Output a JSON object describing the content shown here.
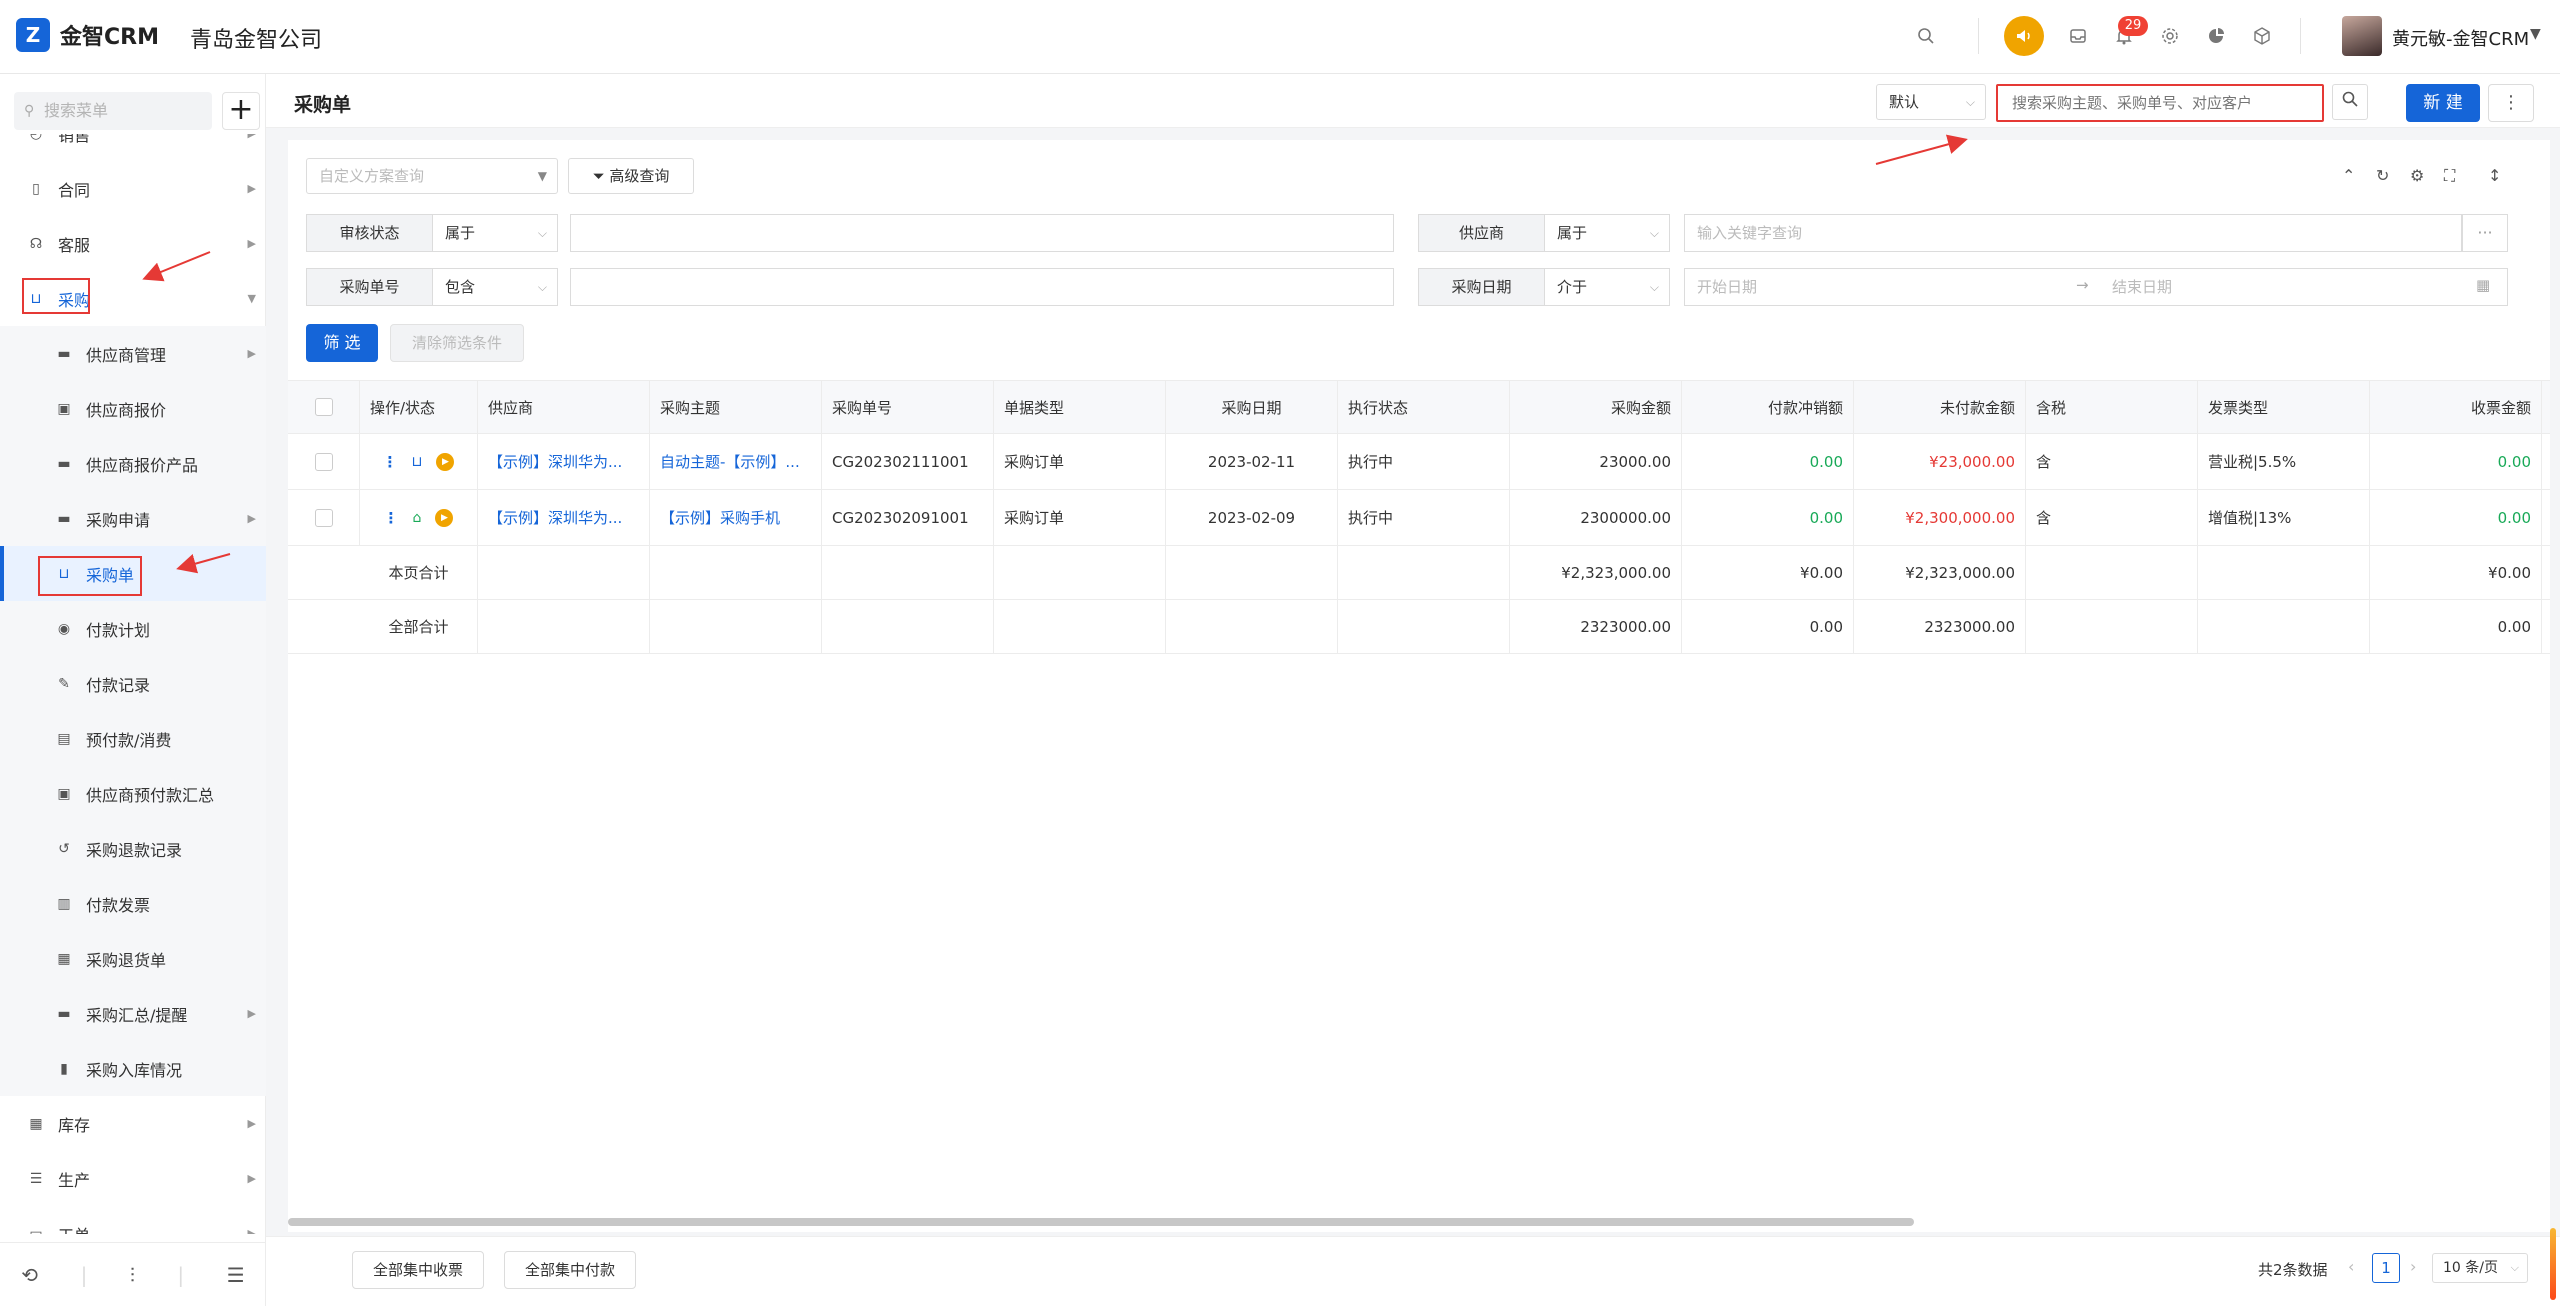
{
  "app": {
    "logo_text": "金智CRM",
    "company": "青岛金智公司"
  },
  "topbar": {
    "notification_count": "29",
    "user_name": "黄元敏-金智CRM"
  },
  "sidebar": {
    "search_placeholder": "搜索菜单",
    "items": [
      {
        "label": "销售",
        "icon": "sales-icon"
      },
      {
        "label": "合同",
        "icon": "contract-icon"
      },
      {
        "label": "客服",
        "icon": "headset-icon"
      },
      {
        "label": "采购",
        "icon": "basket-icon"
      },
      {
        "label": "供应商管理",
        "icon": "folder-icon"
      },
      {
        "label": "供应商报价",
        "icon": "doc-icon"
      },
      {
        "label": "供应商报价产品",
        "icon": "folder-icon"
      },
      {
        "label": "采购申请",
        "icon": "folder-icon"
      },
      {
        "label": "采购单",
        "icon": "basket-icon"
      },
      {
        "label": "付款计划",
        "icon": "clock-icon"
      },
      {
        "label": "付款记录",
        "icon": "pen-icon"
      },
      {
        "label": "预付款/消费",
        "icon": "card-icon"
      },
      {
        "label": "供应商预付款汇总",
        "icon": "doc-icon"
      },
      {
        "label": "采购退款记录",
        "icon": "refund-icon"
      },
      {
        "label": "付款发票",
        "icon": "invoice-icon"
      },
      {
        "label": "采购退货单",
        "icon": "return-icon"
      },
      {
        "label": "采购汇总/提醒",
        "icon": "folder-icon"
      },
      {
        "label": "采购入库情况",
        "icon": "stock-icon"
      },
      {
        "label": "库存",
        "icon": "warehouse-icon"
      },
      {
        "label": "生产",
        "icon": "production-icon"
      },
      {
        "label": "工单",
        "icon": "ticket-icon"
      }
    ]
  },
  "header": {
    "title": "采购单",
    "view_select": "默认",
    "search_placeholder": "搜索采购主题、采购单号、对应客户",
    "new_label": "新 建"
  },
  "filters": {
    "custom_placeholder": "自定义方案查询",
    "advanced_label": "高级查询",
    "audit_label": "审核状态",
    "audit_op": "属于",
    "supplier_label": "供应商",
    "supplier_op": "属于",
    "supplier_placeholder": "输入关键字查询",
    "order_no_label": "采购单号",
    "order_no_op": "包含",
    "date_label": "采购日期",
    "date_op": "介于",
    "date_start": "开始日期",
    "date_end": "结束日期",
    "filter_btn": "筛 选",
    "clear_btn": "清除筛选条件"
  },
  "table": {
    "headers": [
      "操作/状态",
      "供应商",
      "采购主题",
      "采购单号",
      "单据类型",
      "采购日期",
      "执行状态",
      "采购金额",
      "付款冲销额",
      "未付款金额",
      "含税",
      "发票类型",
      "收票金额"
    ],
    "rows": [
      {
        "supplier": "【示例】深圳华为...",
        "subject": "自动主题-【示例】...",
        "order_no": "CG202302111001",
        "doc_type": "采购订单",
        "date": "2023-02-11",
        "exec_status": "执行中",
        "amount": "23000.00",
        "offset": "0.00",
        "unpaid": "¥23,000.00",
        "tax": "含",
        "invoice_type": "营业税|5.5%",
        "received": "0.00"
      },
      {
        "supplier": "【示例】深圳华为...",
        "subject": "【示例】采购手机",
        "order_no": "CG202302091001",
        "doc_type": "采购订单",
        "date": "2023-02-09",
        "exec_status": "执行中",
        "amount": "2300000.00",
        "offset": "0.00",
        "unpaid": "¥2,300,000.00",
        "tax": "含",
        "invoice_type": "增值税|13%",
        "received": "0.00"
      }
    ],
    "page_total": {
      "label": "本页合计",
      "amount": "¥2,323,000.00",
      "offset": "¥0.00",
      "unpaid": "¥2,323,000.00",
      "received": "¥0.00"
    },
    "all_total": {
      "label": "全部合计",
      "amount": "2323000.00",
      "offset": "0.00",
      "unpaid": "2323000.00",
      "received": "0.00"
    }
  },
  "footer": {
    "collect_btn": "全部集中收票",
    "pay_btn": "全部集中付款",
    "total_text": "共2条数据",
    "current_page": "1",
    "page_size": "10 条/页"
  },
  "colors": {
    "accent": "#1565d8",
    "annotation": "#e53935",
    "positive": "#18a957",
    "warning": "#f0a400"
  }
}
